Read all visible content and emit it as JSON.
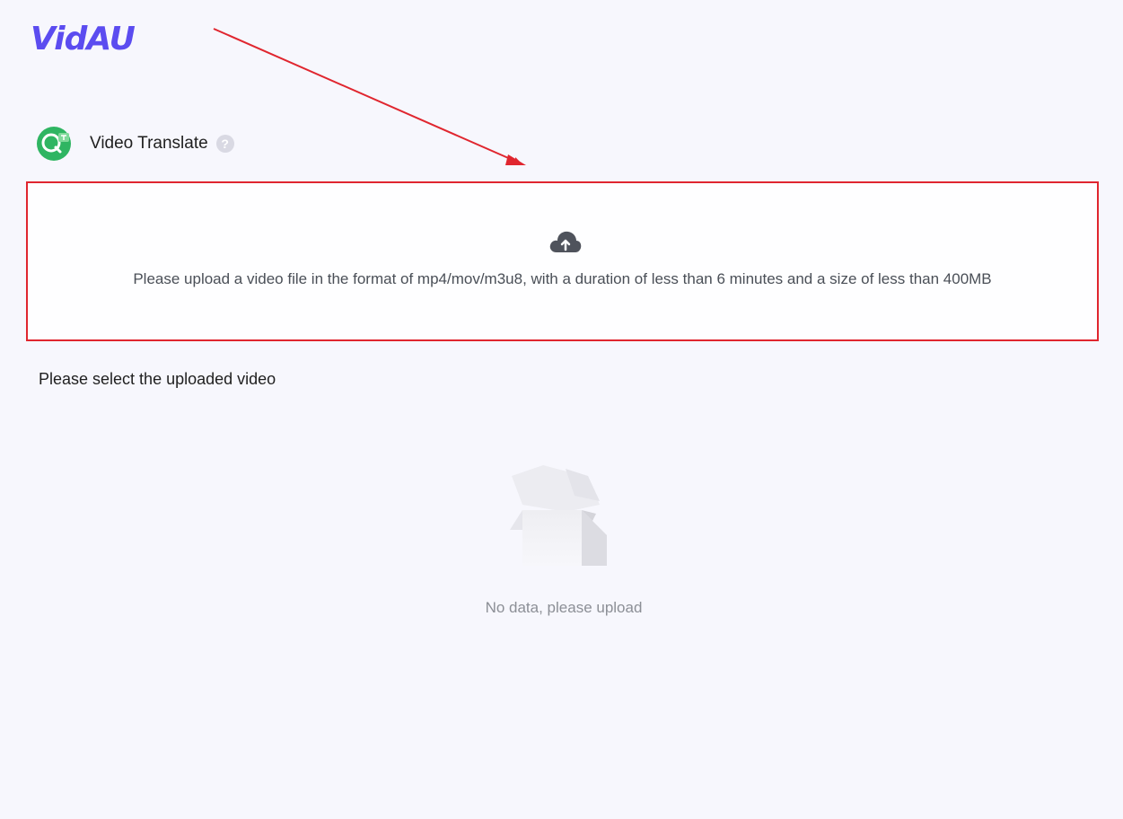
{
  "app": {
    "logo_text": "VidAU"
  },
  "feature": {
    "title": "Video Translate",
    "icon": "video-translate-icon",
    "help_icon": "question-mark-icon",
    "help_glyph": "?"
  },
  "upload": {
    "icon": "cloud-upload-icon",
    "hint": "Please upload a video file in the format of mp4/mov/m3u8, with a duration of less than 6 minutes and a size of less than 400MB"
  },
  "uploaded_section": {
    "title": "Please select the uploaded video",
    "empty_icon": "empty-box-illustration",
    "empty_text": "No data, please upload"
  },
  "colors": {
    "brand": "#5b4cf0",
    "annotation_red": "#e0262f",
    "feature_icon_green": "#2fb562",
    "background": "#f7f7fd"
  }
}
